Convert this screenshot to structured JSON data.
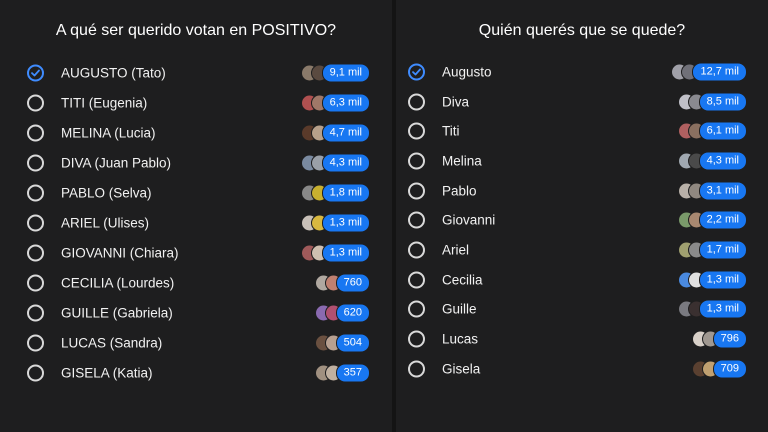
{
  "colors": {
    "accent": "#1877f2",
    "check": "#3f8cff",
    "panel": "#1e1e1f",
    "text": "#f2f2f2"
  },
  "polls": [
    {
      "title": "A qué ser querido votan en POSITIVO?",
      "options": [
        {
          "label": "AUGUSTO (Tato)",
          "votes": "9,1 mil",
          "selected": true,
          "avatars": [
            "#8a7a6a",
            "#5a4a40"
          ]
        },
        {
          "label": "TITI (Eugenia)",
          "votes": "6,3 mil",
          "selected": false,
          "avatars": [
            "#b05050",
            "#a07868"
          ]
        },
        {
          "label": "MELINA (Lucia)",
          "votes": "4,7 mil",
          "selected": false,
          "avatars": [
            "#5a3a2a",
            "#b7a08a"
          ]
        },
        {
          "label": "DIVA (Juan Pablo)",
          "votes": "4,3 mil",
          "selected": false,
          "avatars": [
            "#7a8aa0",
            "#9aa0a8"
          ]
        },
        {
          "label": "PABLO (Selva)",
          "votes": "1,8 mil",
          "selected": false,
          "avatars": [
            "#888888",
            "#c8b030"
          ]
        },
        {
          "label": "ARIEL (Ulises)",
          "votes": "1,3 mil",
          "selected": false,
          "avatars": [
            "#c8c0b8",
            "#d8b840"
          ]
        },
        {
          "label": "GIOVANNI (Chiara)",
          "votes": "1,3 mil",
          "selected": false,
          "avatars": [
            "#a05a5a",
            "#d0c0b0"
          ]
        },
        {
          "label": "CECILIA (Lourdes)",
          "votes": "760",
          "selected": false,
          "avatars": [
            "#b0a8a0",
            "#c08070"
          ]
        },
        {
          "label": "GUILLE (Gabriela)",
          "votes": "620",
          "selected": false,
          "avatars": [
            "#8a6ab0",
            "#b05070"
          ]
        },
        {
          "label": "LUCAS (Sandra)",
          "votes": "504",
          "selected": false,
          "avatars": [
            "#6a5040",
            "#b8a090"
          ]
        },
        {
          "label": "GISELA (Katia)",
          "votes": "357",
          "selected": false,
          "avatars": [
            "#a09080",
            "#c0b0a0"
          ]
        }
      ]
    },
    {
      "title": "Quién querés que se quede?",
      "options": [
        {
          "label": "Augusto",
          "votes": "12,7 mil",
          "selected": true,
          "avatars": [
            "#a0a0a8",
            "#707078"
          ]
        },
        {
          "label": "Diva",
          "votes": "8,5 mil",
          "selected": false,
          "avatars": [
            "#c0c0c8",
            "#8a8a90"
          ]
        },
        {
          "label": "Titi",
          "votes": "6,1 mil",
          "selected": false,
          "avatars": [
            "#b06060",
            "#8a7060"
          ]
        },
        {
          "label": "Melina",
          "votes": "4,3 mil",
          "selected": false,
          "avatars": [
            "#a0a8b0",
            "#4a4a4a"
          ]
        },
        {
          "label": "Pablo",
          "votes": "3,1 mil",
          "selected": false,
          "avatars": [
            "#b8b0a8",
            "#908880"
          ]
        },
        {
          "label": "Giovanni",
          "votes": "2,2 mil",
          "selected": false,
          "avatars": [
            "#7a9a6a",
            "#a88870"
          ]
        },
        {
          "label": "Ariel",
          "votes": "1,7 mil",
          "selected": false,
          "avatars": [
            "#a0a070",
            "#8a8a8a"
          ]
        },
        {
          "label": "Cecilia",
          "votes": "1,3 mil",
          "selected": false,
          "avatars": [
            "#4a8ae0",
            "#e0e0e0"
          ]
        },
        {
          "label": "Guille",
          "votes": "1,3 mil",
          "selected": false,
          "avatars": [
            "#7a7a80",
            "#3a3030"
          ]
        },
        {
          "label": "Lucas",
          "votes": "796",
          "selected": false,
          "avatars": [
            "#d8d0c8",
            "#a09890"
          ]
        },
        {
          "label": "Gisela",
          "votes": "709",
          "selected": false,
          "avatars": [
            "#5a4030",
            "#c0a070"
          ]
        }
      ]
    }
  ]
}
